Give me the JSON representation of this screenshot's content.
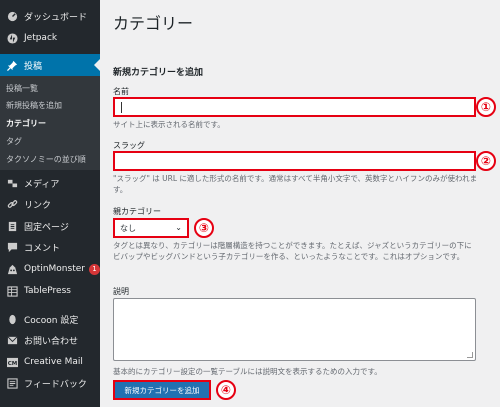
{
  "sidebar": {
    "items": [
      {
        "label": "ダッシュボード",
        "icon": "dashboard-icon"
      },
      {
        "label": "Jetpack",
        "icon": "jetpack-icon"
      },
      {
        "label": "投稿",
        "icon": "pin-icon"
      },
      {
        "label": "メディア",
        "icon": "media-icon"
      },
      {
        "label": "リンク",
        "icon": "link-icon"
      },
      {
        "label": "固定ページ",
        "icon": "page-icon"
      },
      {
        "label": "コメント",
        "icon": "comment-icon"
      },
      {
        "label": "OptinMonster",
        "icon": "optinmonster-icon",
        "badge": "1"
      },
      {
        "label": "TablePress",
        "icon": "table-icon"
      },
      {
        "label": "Cocoon 設定",
        "icon": "cocoon-icon"
      },
      {
        "label": "お問い合わせ",
        "icon": "mail-icon"
      },
      {
        "label": "Creative Mail",
        "icon": "creative-mail-icon"
      },
      {
        "label": "フィードバック",
        "icon": "feedback-icon"
      }
    ],
    "submenu": [
      "投稿一覧",
      "新規投稿を追加",
      "カテゴリー",
      "タグ",
      "タクソノミーの並び順"
    ]
  },
  "main": {
    "title": "カテゴリー",
    "form_heading": "新規カテゴリーを追加",
    "name": {
      "label": "名前",
      "value": "",
      "help": "サイト上に表示される名前です。"
    },
    "slug": {
      "label": "スラッグ",
      "value": "",
      "help": "\"スラッグ\" は URL に適した形式の名前です。通常はすべて半角小文字で、英数字とハイフンのみが使われます。"
    },
    "parent": {
      "label": "親カテゴリー",
      "selected": "なし",
      "help": "タグとは異なり、カテゴリーは階層構造を持つことができます。たとえば、ジャズというカテゴリーの下にビバップやビッグバンドという子カテゴリーを作る、といったようなことです。これはオプションです。"
    },
    "description": {
      "label": "説明",
      "value": "",
      "help": "基本的にカテゴリー設定の一覧テーブルには説明文を表示するための入力です。"
    },
    "submit_label": "新規カテゴリーを追加"
  },
  "annotations": [
    "①",
    "②",
    "③",
    "④"
  ],
  "colors": {
    "sidebar_bg": "#23282d",
    "active": "#0073aa",
    "button": "#2271b1",
    "annotation": "#e60012"
  }
}
